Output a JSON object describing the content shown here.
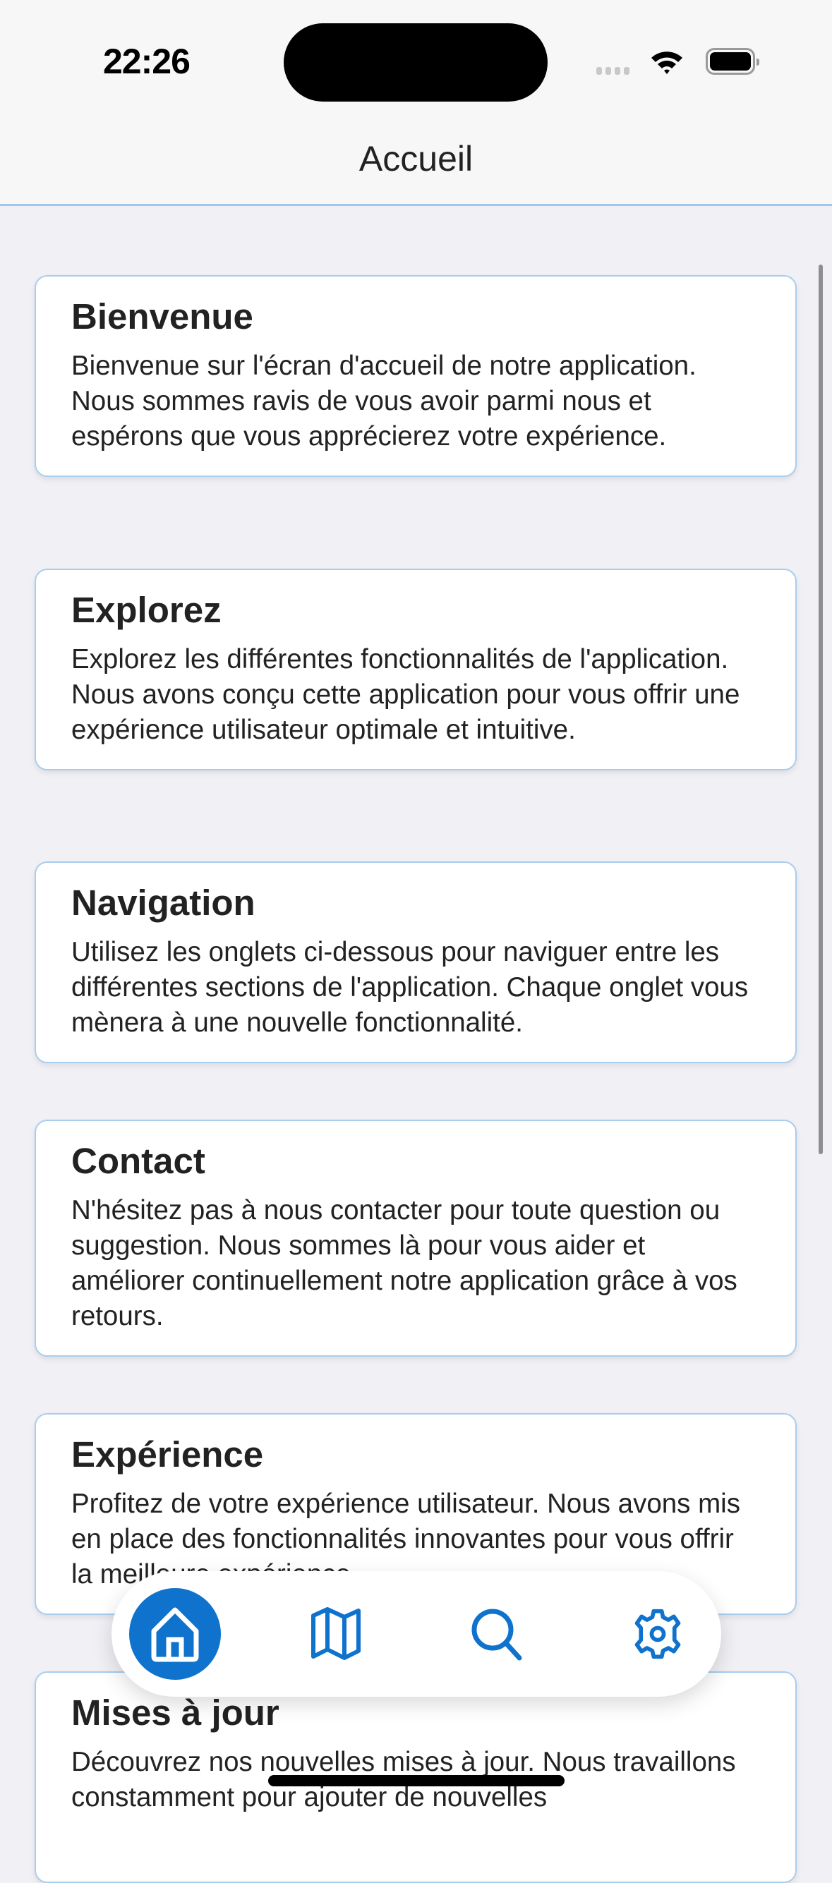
{
  "status_bar": {
    "time": "22:26"
  },
  "header": {
    "title": "Accueil"
  },
  "cards": [
    {
      "title": "Bienvenue",
      "body": "Bienvenue sur l'écran d'accueil de notre application. Nous sommes ravis de vous avoir parmi nous et espérons que vous apprécierez votre expérience."
    },
    {
      "title": "Explorez",
      "body": "Explorez les différentes fonctionnalités de l'application. Nous avons conçu cette application pour vous offrir une expérience utilisateur optimale et intuitive."
    },
    {
      "title": "Navigation",
      "body": "Utilisez les onglets ci-dessous pour naviguer entre les différentes sections de l'application. Chaque onglet vous mènera à une nouvelle fonctionnalité."
    },
    {
      "title": "Contact",
      "body": "N'hésitez pas à nous contacter pour toute question ou suggestion. Nous sommes là pour vous aider et améliorer continuellement notre application grâce à vos retours."
    },
    {
      "title": "Expérience",
      "body": "Profitez de votre expérience utilisateur. Nous avons mis en place des fonctionnalités innovantes pour vous offrir la meilleure expérience."
    },
    {
      "title": "Mises à jour",
      "body": "Découvrez nos nouvelles mises à jour. Nous travaillons constamment pour ajouter de nouvelles"
    }
  ],
  "tab_bar": {
    "accent": "#0f72cc",
    "tabs": [
      {
        "icon": "home-icon",
        "active": true
      },
      {
        "icon": "map-icon",
        "active": false
      },
      {
        "icon": "search-icon",
        "active": false
      },
      {
        "icon": "gear-icon",
        "active": false
      }
    ]
  }
}
